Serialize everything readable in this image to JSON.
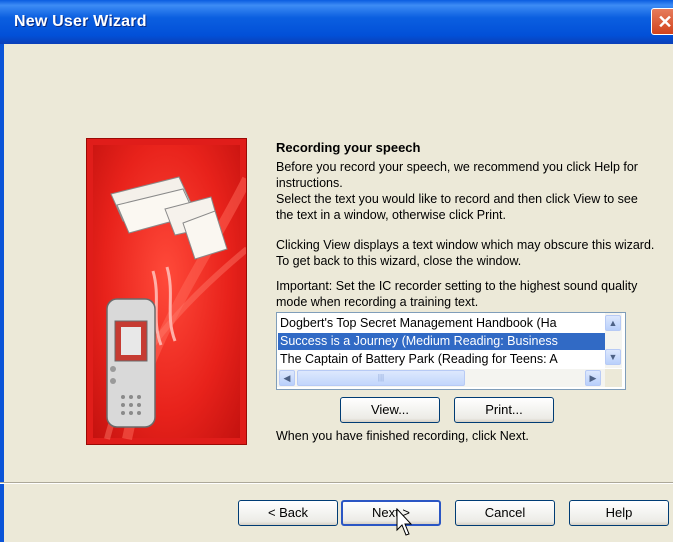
{
  "window": {
    "title": "New User Wizard",
    "close_glyph": "✕"
  },
  "content": {
    "heading": "Recording your speech",
    "para1": "Before you record your speech, we recommend you click Help for instructions.",
    "para2": "Select the text you would like to record and then click View to see the text in a window, otherwise click Print.",
    "para3": "Clicking View displays a text window which may obscure this wizard. To get back to this wizard, close the window.",
    "para4": "Important: Set the IC recorder setting to the highest sound quality mode when recording a training text.",
    "list": {
      "items": [
        {
          "label": "Dogbert's Top Secret Management Handbook (Ha"
        },
        {
          "label": "Success is a Journey (Medium Reading: Business"
        },
        {
          "label": "The Captain of Battery Park (Reading for Teens: A"
        }
      ],
      "selected_index": 1
    },
    "view_button": "View...",
    "print_button": "Print...",
    "finished_text": "When you have finished recording, click Next."
  },
  "footer": {
    "back_button": "< Back",
    "next_button": "Next >",
    "cancel_button": "Cancel",
    "help_button": "Help"
  },
  "icons": {
    "art": "recorder-illustration",
    "close": "close-icon",
    "cursor": "mouse-cursor-icon"
  },
  "colors": {
    "titlebar": "#0a5ce0",
    "art_red": "#e01d1a",
    "selection": "#316ac5"
  }
}
